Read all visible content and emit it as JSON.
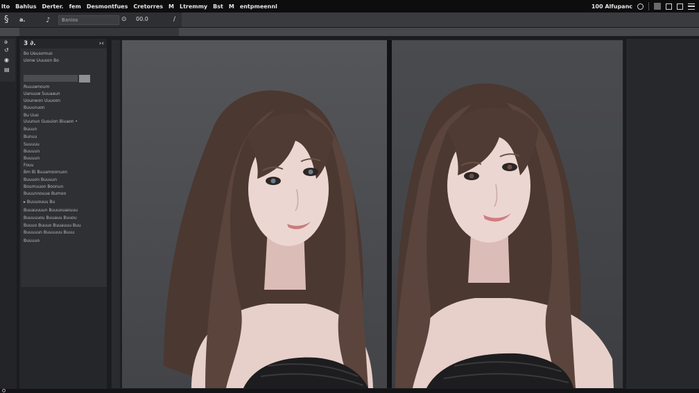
{
  "menubar": {
    "items": [
      "lto",
      "Bahlus",
      "Derter.",
      "fem",
      "Desmontfues",
      "Cretorres",
      "M",
      "Ltremmy",
      "Bst",
      "M",
      "entpmeennl"
    ],
    "right_label": "100 Alfupanc",
    "right_icons": [
      "circle-icon",
      "square-icon",
      "box-icon",
      "panel-icon",
      "menu-icon"
    ]
  },
  "optionsbar": {
    "tool_glyph": "§",
    "label": "a.",
    "brush_glyph": "♪",
    "field_value": "Banios",
    "icons": [
      "⊙",
      "⊕"
    ],
    "text": "00.0",
    "pen_glyph": "∕"
  },
  "toolstrip": {
    "tools": [
      "ə",
      "↺",
      "◉",
      "▤"
    ]
  },
  "panel": {
    "title": "3 ∂.",
    "menu_glyph": "›‹",
    "rows": [
      "Bo Ueusomuo",
      "Uonw Uuuson Bo",
      "Ruuuwnoum",
      "Uanuuw Suuaaun",
      "Uounwon Uuuoon",
      "Buuunuon",
      "Bu Uuo",
      "Uuunun Gusuion Biuaon •",
      "Buuun",
      "Bunuu",
      "Suuuuu",
      "Buuuun",
      "Buuuun",
      "Fouu",
      "Bm Bi Buuamoonuon",
      "Buuuon Buuuun",
      "Boumuuon Boonun",
      "Buuunnouue Bumoo",
      "▸ Buuuouuu Bu",
      "Buuauuuun Buuuouaouuu",
      "Buuuuuou Buuauu Buuou",
      "Buuuo Buuuo Buuauuu Buu",
      "Buuuuun Buuuuuu Buuu",
      "Buuuuo"
    ]
  },
  "colors": {
    "menubar_bg": "#0d0d0e",
    "panel_bg": "#2f3033",
    "canvas_bg": "#4a4b4f",
    "hair": "#4a3730",
    "skin": "#e9d3cf",
    "dress": "#1d1d1f"
  }
}
